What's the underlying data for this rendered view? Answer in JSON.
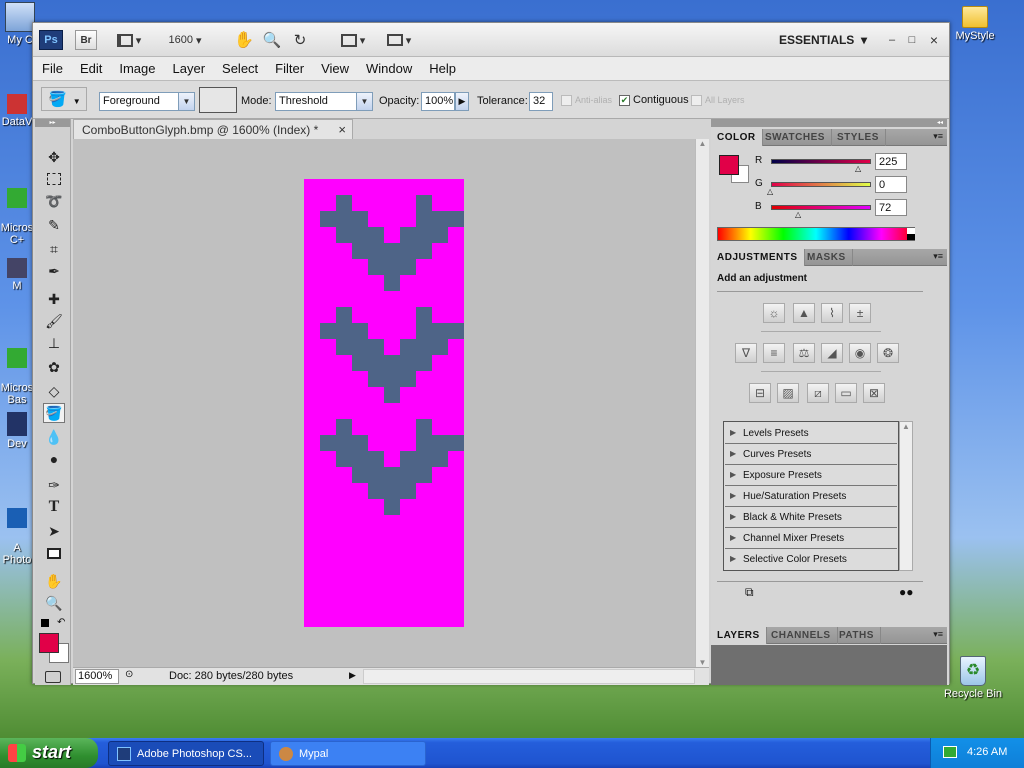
{
  "desktop": {
    "icons": [
      {
        "label": "My C"
      },
      {
        "label": "DataV"
      },
      {
        "label": "Micros\nC+"
      },
      {
        "label": "M"
      },
      {
        "label": "Micros\nBas"
      },
      {
        "label": "Dev"
      },
      {
        "label": "A\nPhoto"
      },
      {
        "label": "MyStyle"
      },
      {
        "label": "Recycle Bin"
      }
    ]
  },
  "app": {
    "ps_logo": "Ps",
    "br_logo": "Br",
    "zoom_select": "1600",
    "workspace": "ESSENTIALS",
    "window_controls": [
      "–",
      "□",
      "×"
    ],
    "menu": [
      "File",
      "Edit",
      "Image",
      "Layer",
      "Select",
      "Filter",
      "View",
      "Window",
      "Help"
    ],
    "options": {
      "fill_source": "Foreground",
      "mode_label": "Mode:",
      "mode_value": "Threshold",
      "opacity_label": "Opacity:",
      "opacity_value": "100%",
      "tolerance_label": "Tolerance:",
      "tolerance_value": "32",
      "antialias_label": "Anti-alias",
      "contiguous_label": "Contiguous",
      "all_layers_label": "All Layers"
    },
    "document": {
      "tab_title": "ComboButtonGlyph.bmp @ 1600% (Index) *",
      "close": "×",
      "canvas_bg": "#ff00ff",
      "glyph_color": "#4e6487"
    },
    "status": {
      "zoom": "1600%",
      "doc_info": "Doc: 280 bytes/280 bytes"
    }
  },
  "panels": {
    "color": {
      "tabs": [
        "COLOR",
        "SWATCHES",
        "STYLES"
      ],
      "channels": [
        {
          "label": "R",
          "value": "225",
          "level": 0.88
        },
        {
          "label": "G",
          "value": "0",
          "level": 0
        },
        {
          "label": "B",
          "value": "72",
          "level": 0.28
        }
      ],
      "fg_color": "#e10048",
      "bg_color": "#ffffff"
    },
    "adjustments": {
      "tabs": [
        "ADJUSTMENTS",
        "MASKS"
      ],
      "heading": "Add an adjustment",
      "presets": [
        "Levels Presets",
        "Curves Presets",
        "Exposure Presets",
        "Hue/Saturation Presets",
        "Black & White Presets",
        "Channel Mixer Presets",
        "Selective Color Presets"
      ]
    },
    "layers": {
      "tabs": [
        "LAYERS",
        "CHANNELS",
        "PATHS"
      ]
    }
  },
  "taskbar": {
    "start": "start",
    "tasks": [
      {
        "label": "Adobe Photoshop CS..."
      },
      {
        "label": "Mypal"
      }
    ],
    "clock": "4:26 AM"
  }
}
